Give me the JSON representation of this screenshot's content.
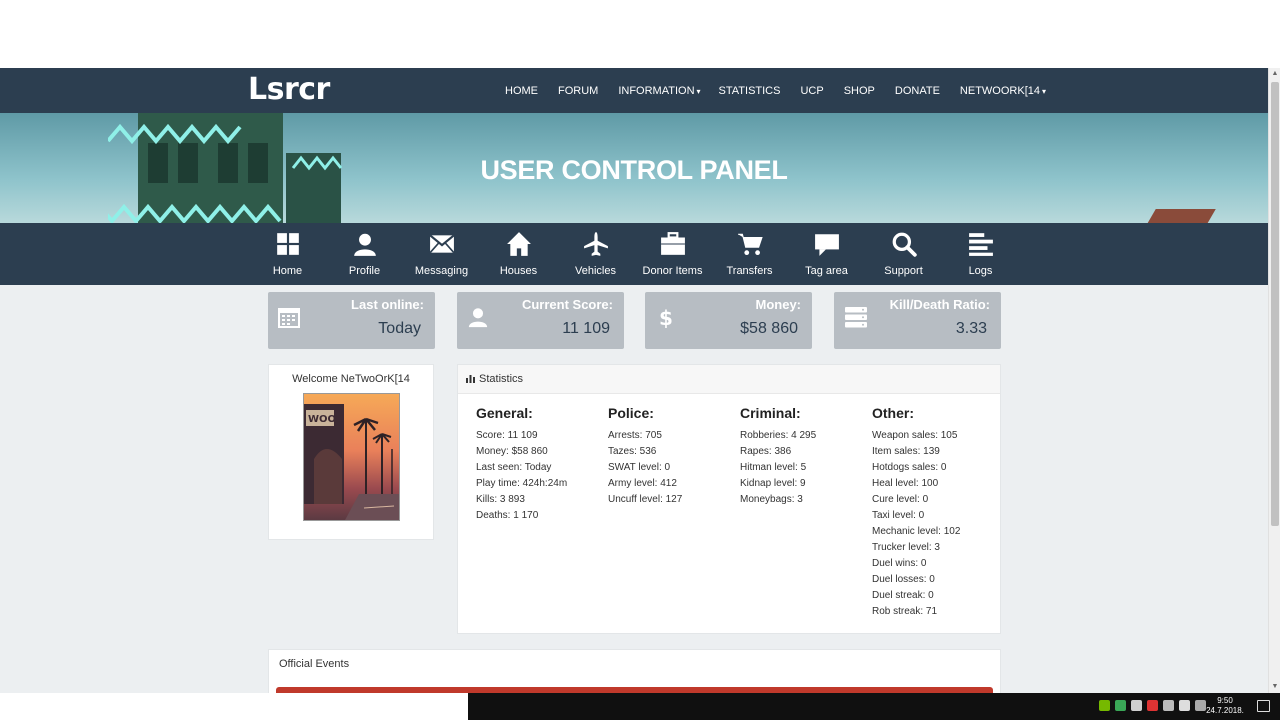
{
  "site": {
    "logo": "Lsrcr",
    "banner_title": "USER CONTROL PANEL"
  },
  "nav": {
    "items": [
      {
        "label": "HOME",
        "caret": ""
      },
      {
        "label": "FORUM",
        "caret": ""
      },
      {
        "label": "INFORMATION",
        "caret": "▾"
      },
      {
        "label": "STATISTICS",
        "caret": ""
      },
      {
        "label": "UCP",
        "caret": ""
      },
      {
        "label": "SHOP",
        "caret": ""
      },
      {
        "label": "DONATE",
        "caret": ""
      },
      {
        "label": "NETWOORK[14",
        "caret": "▾"
      }
    ]
  },
  "ucp_menu": {
    "items": [
      {
        "label": "Home",
        "icon": "grid-icon"
      },
      {
        "label": "Profile",
        "icon": "user-icon"
      },
      {
        "label": "Messaging",
        "icon": "envelope-icon"
      },
      {
        "label": "Houses",
        "icon": "house-icon"
      },
      {
        "label": "Vehicles",
        "icon": "airplane-icon"
      },
      {
        "label": "Donor Items",
        "icon": "briefcase-icon"
      },
      {
        "label": "Transfers",
        "icon": "cart-icon"
      },
      {
        "label": "Tag area",
        "icon": "comment-icon"
      },
      {
        "label": "Support",
        "icon": "search-icon"
      },
      {
        "label": "Logs",
        "icon": "list-icon"
      }
    ]
  },
  "stat_boxes": [
    {
      "label": "Last online:",
      "value": "Today",
      "icon": "calendar-icon"
    },
    {
      "label": "Current Score:",
      "value": "11 109",
      "icon": "user-icon"
    },
    {
      "label": "Money:",
      "value": "$58 860",
      "icon": "dollar-icon"
    },
    {
      "label": "Kill/Death Ratio:",
      "value": "3.33",
      "icon": "server-icon"
    }
  ],
  "welcome": {
    "text": "Welcome NeTwoOrK[14",
    "avatar_text": "WOOD"
  },
  "statistics": {
    "title": "Statistics",
    "columns": [
      {
        "heading": "General:",
        "lines": [
          "Score: 11 109",
          "Money: $58 860",
          "Last seen: Today",
          "Play time: 424h:24m",
          "Kills: 3 893",
          "Deaths: 1 170"
        ]
      },
      {
        "heading": "Police:",
        "lines": [
          "Arrests: 705",
          "Tazes: 536",
          "SWAT level: 0",
          "Army level: 412",
          "Uncuff level: 127"
        ]
      },
      {
        "heading": "Criminal:",
        "lines": [
          "Robberies: 4 295",
          "Rapes: 386",
          "Hitman level: 5",
          "Kidnap level: 9",
          "Moneybags: 3"
        ]
      },
      {
        "heading": "Other:",
        "lines": [
          "Weapon sales: 105",
          "Item sales: 139",
          "Hotdogs sales: 0",
          "Heal level: 100",
          "Cure level: 0",
          "Taxi level: 0",
          "Mechanic level: 102",
          "Trucker level: 3",
          "Duel wins: 0",
          "Duel losses: 0",
          "Duel streak: 0",
          "Rob streak: 71"
        ]
      }
    ]
  },
  "events": {
    "title": "Official Events"
  },
  "taskbar": {
    "time": "9:50",
    "date": "24.7.2018."
  },
  "colors": {
    "nav_bg": "#2c3e50",
    "page_bg": "#eceff1",
    "stat_box_bg": "#b7bdc3",
    "accent_red": "#c0392b"
  }
}
